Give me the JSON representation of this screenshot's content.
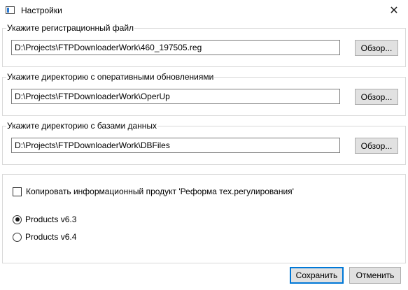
{
  "window": {
    "title": "Настройки",
    "app_icon": "window-icon",
    "close_label": "✕"
  },
  "registration": {
    "label": "Укажите регистрационный файл",
    "path": "D:\\Projects\\FTPDownloaderWork\\460_197505.reg",
    "browse_label": "Обзор..."
  },
  "updates": {
    "label": "Укажите директорию с оперативными обновлениями",
    "path": "D:\\Projects\\FTPDownloaderWork\\OperUp",
    "browse_label": "Обзор..."
  },
  "databases": {
    "label": "Укажите директорию с базами данных",
    "path": "D:\\Projects\\FTPDownloaderWork\\DBFiles",
    "browse_label": "Обзор..."
  },
  "options": {
    "copy_label": "Копировать информационный продукт 'Реформа тех.регулирования'",
    "copy_checked": false,
    "radio_options": [
      {
        "label": "Products v6.3",
        "selected": true
      },
      {
        "label": "Products v6.4",
        "selected": false
      }
    ]
  },
  "footer": {
    "save_label": "Сохранить",
    "cancel_label": "Отменить"
  }
}
